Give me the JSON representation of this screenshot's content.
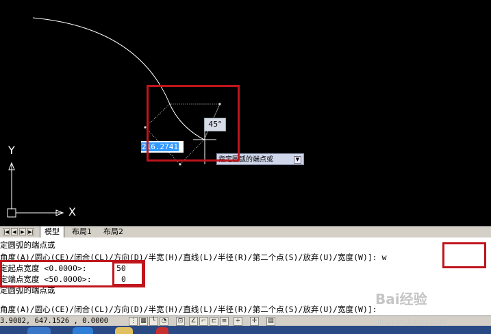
{
  "canvas": {
    "ucs_x_label": "X",
    "ucs_y_label": "Y",
    "dynamic_input_value": "216.2741",
    "angle_tooltip": "45°",
    "prompt_tooltip": "指定圆弧的端点或"
  },
  "layout_tabs": {
    "nav_buttons": [
      "|◀",
      "◀",
      "▶",
      "▶|"
    ],
    "tabs": [
      "模型",
      "布局1",
      "布局2"
    ],
    "active_tab": "模型"
  },
  "command_history": [
    "定圆弧的端点或",
    "角度(A)/圆心(CE)/闭合(CL)/方向(D)/半宽(H)/直线(L)/半径(R)/第二个点(S)/放弃(U)/宽度(W)]: w",
    "定起点宽度 <0.0000>:",
    "定端点宽度 <50.0000>:",
    "定圆弧的端点或",
    "",
    "角度(A)/圆心(CE)/闭合(CL)/方向(D)/半宽(H)/直线(L)/半径(R)/第二个点(S)/放弃(U)/宽度(W)]:"
  ],
  "command_inputs": {
    "start_width": "50",
    "end_width": "0"
  },
  "status_bar": {
    "coordinates": "3.9082, 647.1526 , 0.0000"
  },
  "watermark": {
    "brand": "Bai经验",
    "url": "jingyan.baidu.com"
  },
  "colors": {
    "highlight_box": "#c0141c",
    "canvas_bg": "#000000",
    "selection": "#3399ff"
  }
}
